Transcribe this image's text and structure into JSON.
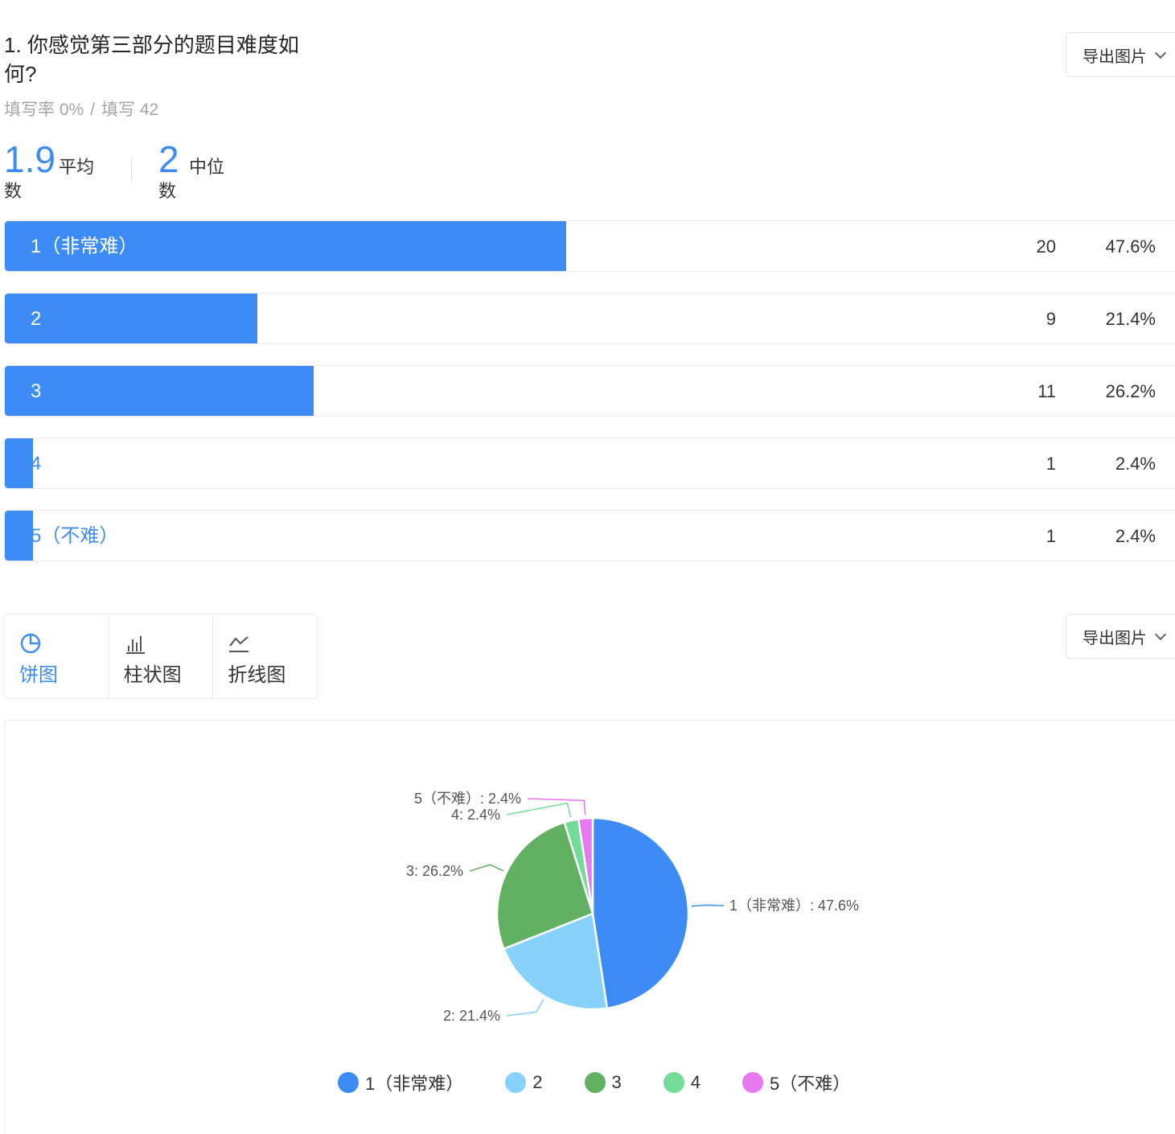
{
  "question": {
    "title": "1. 你感觉第三部分的题目难度如何?",
    "fill_rate_label": "填写率 0%",
    "separator": "/",
    "fill_count_label": "填写 42"
  },
  "export": {
    "label": "导出图片"
  },
  "stats": {
    "mean_value": "1.9",
    "mean_label_1": "平均",
    "mean_label_2": "数",
    "median_value": "2",
    "median_label_1": "中位",
    "median_label_2": "数"
  },
  "options": [
    {
      "label": "1（非常难）",
      "count": "20",
      "percent": "47.6%",
      "fraction": 0.476
    },
    {
      "label": "2",
      "count": "9",
      "percent": "21.4%",
      "fraction": 0.214
    },
    {
      "label": "3",
      "count": "11",
      "percent": "26.2%",
      "fraction": 0.262
    },
    {
      "label": "4",
      "count": "1",
      "percent": "2.4%",
      "fraction": 0.024
    },
    {
      "label": "5（不难）",
      "count": "1",
      "percent": "2.4%",
      "fraction": 0.024
    }
  ],
  "chart_tabs": [
    {
      "label": "饼图",
      "icon": "pie-chart-icon",
      "active": true
    },
    {
      "label": "柱状图",
      "icon": "bar-chart-icon",
      "active": false
    },
    {
      "label": "折线图",
      "icon": "line-chart-icon",
      "active": false
    }
  ],
  "chart_data": {
    "type": "pie",
    "categories": [
      "1（非常难）",
      "2",
      "3",
      "4",
      "5（不难）"
    ],
    "values": [
      47.6,
      21.4,
      26.2,
      2.4,
      2.4
    ],
    "slice_labels": [
      "1（非常难）: 47.6%",
      "2: 21.4%",
      "3: 26.2%",
      "4: 2.4%",
      "5（不难）: 2.4%"
    ],
    "colors": [
      "#3d8cf5",
      "#86d2fb",
      "#62b062",
      "#72dc98",
      "#e678f0"
    ],
    "legend_position": "bottom"
  },
  "colors": {
    "accent": "#3d8cf5"
  }
}
